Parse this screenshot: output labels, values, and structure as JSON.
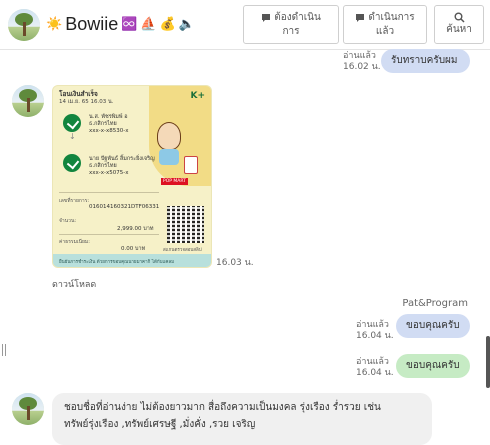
{
  "header": {
    "name": "Bowiie",
    "name_emojis": [
      "☀️",
      "♾️",
      "⛵",
      "💰",
      "🔈"
    ],
    "buttons": {
      "pending": {
        "label_line1": "ต้องดำเนิน",
        "label_line2": "การ",
        "icon": "speech-bubble-icon"
      },
      "done": {
        "label_line1": "ดำเนินการ",
        "label_line2": "แล้ว",
        "icon": "speech-bubble-icon"
      },
      "search": {
        "label": "ค้นหา",
        "icon": "search-icon"
      }
    }
  },
  "messages": {
    "m1": {
      "read": "อ่านแล้ว",
      "time": "16.02 น.",
      "text": "รับทราบครับผม"
    },
    "slip_time": "16.03 น.",
    "download_label": "ดาวน์โหลด",
    "sender_name": "Pat&Program",
    "m2": {
      "read": "อ่านแล้ว",
      "time": "16.04 น.",
      "text": "ขอบคุณครับ"
    },
    "m3": {
      "read": "อ่านแล้ว",
      "time": "16.04 น.",
      "text": "ขอบคุณครับ"
    },
    "m4": {
      "text_line1": "ชอบชื่อที่อ่านง่าย ไม่ต้องยาวมาก สื่อถึงความเป็นมงคล รุ่งเรือง ร่ำรวย  เช่น",
      "text_line2": "ทรัพย์รุ่งเรือง ,ทรัพย์เศรษฐี ,มั่งคั่ง ,รวย เจริญ"
    }
  },
  "slip": {
    "title": "โอนเงินสำเร็จ",
    "datetime": "14 เม.ย. 65 16.03 น.",
    "brand": "K+",
    "from_name": "น.ส. พัชรพิมพ์ อ",
    "from_bank": "ธ.กสิกรไทย",
    "from_acct": "xxx-x-x8530-x",
    "to_name": "นาย ปัฐพันธ์ ลิ้มกระยิ่งเจริญ",
    "to_bank": "ธ.กสิกรไทย",
    "to_acct": "xxx-x-x5075-x",
    "ref_label": "เลขที่รายการ:",
    "ref_value": "016014160321DTF06331",
    "amount_label": "จำนวน:",
    "amount_value": "2,999.00 บาท",
    "fee_label": "ค่าธรรมเนียม:",
    "fee_value": "0.00 บาท",
    "qr_caption": "สแกนตรวจสอบสลิป",
    "footer": "ยืนยันการชำระเงิน ด้วยการขอบคุณนายมาคากิ ได้กับแคลม",
    "sticker_tag": "POP MART"
  }
}
